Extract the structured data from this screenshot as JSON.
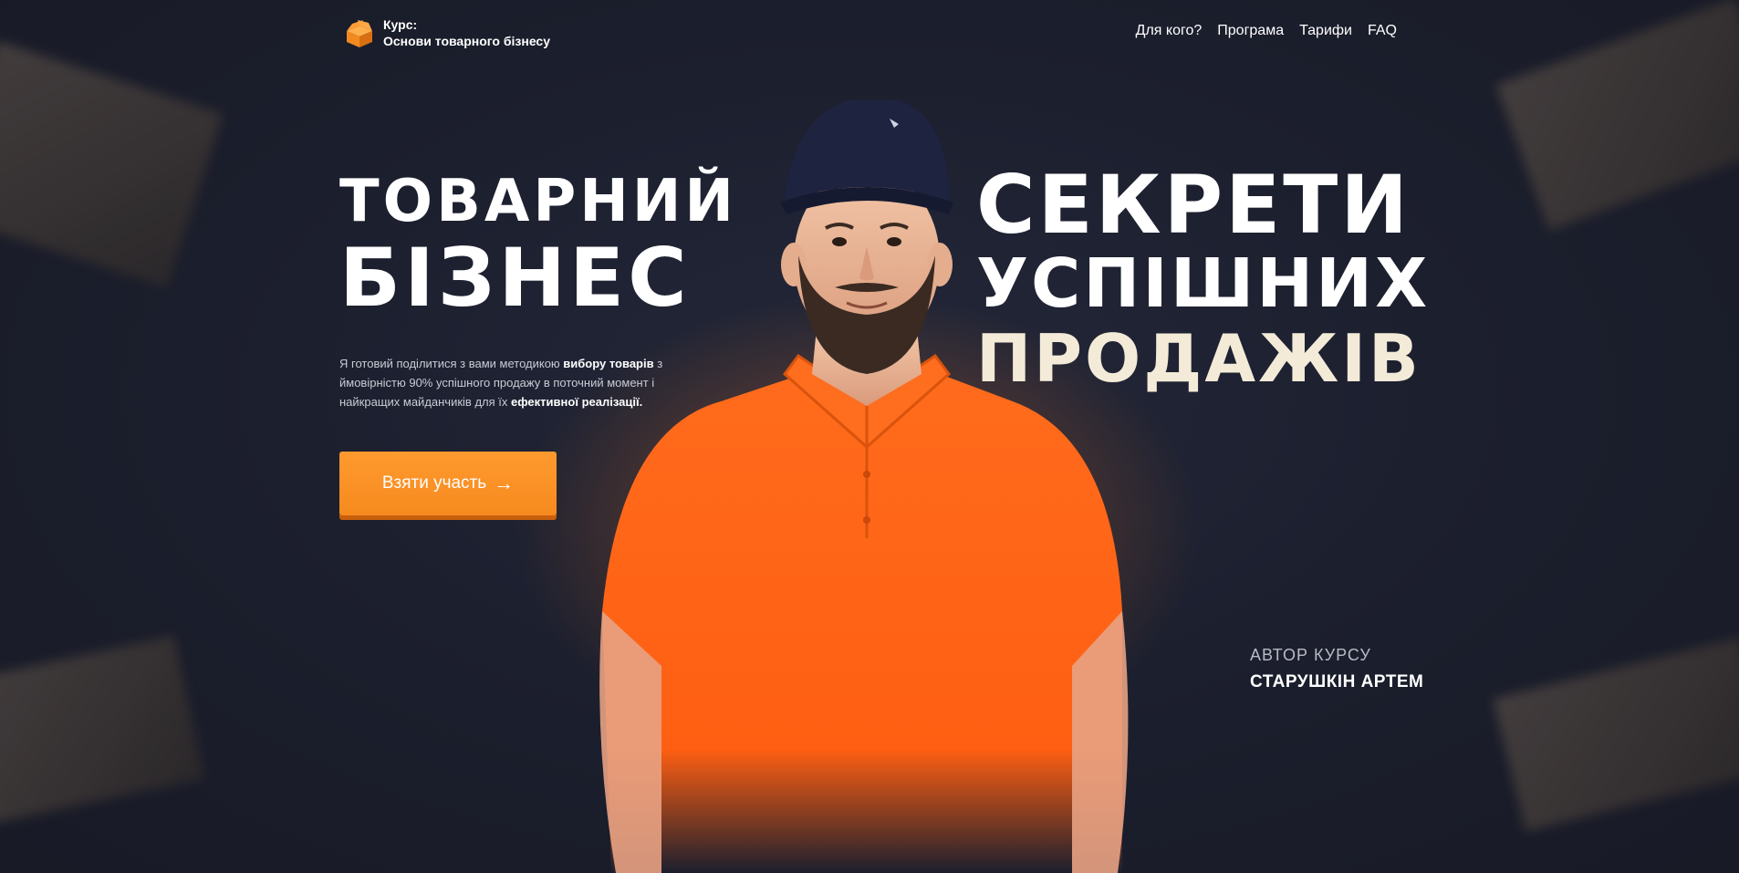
{
  "header": {
    "logo_line1": "Курс:",
    "logo_line2": "Основи товарного бізнесу",
    "nav": [
      "Для кого?",
      "Програма",
      "Тарифи",
      "FAQ"
    ]
  },
  "hero": {
    "headline_left_1": "ТОВАРНИЙ",
    "headline_left_2": "БІЗНЕС",
    "headline_right_1": "СЕКРЕТИ",
    "headline_right_2": "УСПІШНИХ",
    "headline_right_3": "ПРОДАЖІВ",
    "description_part1": "Я готовий поділитися з вами методикою ",
    "description_bold1": "вибору товарів",
    "description_part2": " з ймовірністю 90% успішного продажу в поточний момент і найкращих майданчиків для їх ",
    "description_bold2": "ефективної реалізації.",
    "cta_label": "Взяти участь",
    "cta_arrow": "→"
  },
  "author": {
    "label": "АВТОР КУРСУ",
    "name": "СТАРУШКІН АРТЕМ"
  },
  "colors": {
    "background": "#1c1f2e",
    "accent": "#f68a1f",
    "shirt": "#ff6a1a",
    "cap": "#1e2340"
  },
  "icons": {
    "logo": "box-icon",
    "cta": "arrow-right-icon"
  }
}
